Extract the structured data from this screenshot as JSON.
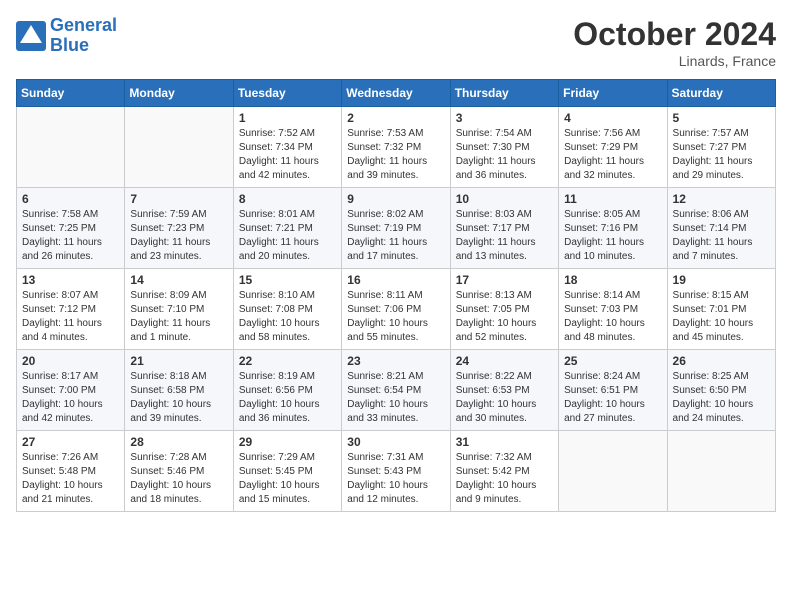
{
  "header": {
    "logo_line1": "General",
    "logo_line2": "Blue",
    "month": "October 2024",
    "location": "Linards, France"
  },
  "weekdays": [
    "Sunday",
    "Monday",
    "Tuesday",
    "Wednesday",
    "Thursday",
    "Friday",
    "Saturday"
  ],
  "weeks": [
    [
      {
        "day": "",
        "info": ""
      },
      {
        "day": "",
        "info": ""
      },
      {
        "day": "1",
        "info": "Sunrise: 7:52 AM\nSunset: 7:34 PM\nDaylight: 11 hours and 42 minutes."
      },
      {
        "day": "2",
        "info": "Sunrise: 7:53 AM\nSunset: 7:32 PM\nDaylight: 11 hours and 39 minutes."
      },
      {
        "day": "3",
        "info": "Sunrise: 7:54 AM\nSunset: 7:30 PM\nDaylight: 11 hours and 36 minutes."
      },
      {
        "day": "4",
        "info": "Sunrise: 7:56 AM\nSunset: 7:29 PM\nDaylight: 11 hours and 32 minutes."
      },
      {
        "day": "5",
        "info": "Sunrise: 7:57 AM\nSunset: 7:27 PM\nDaylight: 11 hours and 29 minutes."
      }
    ],
    [
      {
        "day": "6",
        "info": "Sunrise: 7:58 AM\nSunset: 7:25 PM\nDaylight: 11 hours and 26 minutes."
      },
      {
        "day": "7",
        "info": "Sunrise: 7:59 AM\nSunset: 7:23 PM\nDaylight: 11 hours and 23 minutes."
      },
      {
        "day": "8",
        "info": "Sunrise: 8:01 AM\nSunset: 7:21 PM\nDaylight: 11 hours and 20 minutes."
      },
      {
        "day": "9",
        "info": "Sunrise: 8:02 AM\nSunset: 7:19 PM\nDaylight: 11 hours and 17 minutes."
      },
      {
        "day": "10",
        "info": "Sunrise: 8:03 AM\nSunset: 7:17 PM\nDaylight: 11 hours and 13 minutes."
      },
      {
        "day": "11",
        "info": "Sunrise: 8:05 AM\nSunset: 7:16 PM\nDaylight: 11 hours and 10 minutes."
      },
      {
        "day": "12",
        "info": "Sunrise: 8:06 AM\nSunset: 7:14 PM\nDaylight: 11 hours and 7 minutes."
      }
    ],
    [
      {
        "day": "13",
        "info": "Sunrise: 8:07 AM\nSunset: 7:12 PM\nDaylight: 11 hours and 4 minutes."
      },
      {
        "day": "14",
        "info": "Sunrise: 8:09 AM\nSunset: 7:10 PM\nDaylight: 11 hours and 1 minute."
      },
      {
        "day": "15",
        "info": "Sunrise: 8:10 AM\nSunset: 7:08 PM\nDaylight: 10 hours and 58 minutes."
      },
      {
        "day": "16",
        "info": "Sunrise: 8:11 AM\nSunset: 7:06 PM\nDaylight: 10 hours and 55 minutes."
      },
      {
        "day": "17",
        "info": "Sunrise: 8:13 AM\nSunset: 7:05 PM\nDaylight: 10 hours and 52 minutes."
      },
      {
        "day": "18",
        "info": "Sunrise: 8:14 AM\nSunset: 7:03 PM\nDaylight: 10 hours and 48 minutes."
      },
      {
        "day": "19",
        "info": "Sunrise: 8:15 AM\nSunset: 7:01 PM\nDaylight: 10 hours and 45 minutes."
      }
    ],
    [
      {
        "day": "20",
        "info": "Sunrise: 8:17 AM\nSunset: 7:00 PM\nDaylight: 10 hours and 42 minutes."
      },
      {
        "day": "21",
        "info": "Sunrise: 8:18 AM\nSunset: 6:58 PM\nDaylight: 10 hours and 39 minutes."
      },
      {
        "day": "22",
        "info": "Sunrise: 8:19 AM\nSunset: 6:56 PM\nDaylight: 10 hours and 36 minutes."
      },
      {
        "day": "23",
        "info": "Sunrise: 8:21 AM\nSunset: 6:54 PM\nDaylight: 10 hours and 33 minutes."
      },
      {
        "day": "24",
        "info": "Sunrise: 8:22 AM\nSunset: 6:53 PM\nDaylight: 10 hours and 30 minutes."
      },
      {
        "day": "25",
        "info": "Sunrise: 8:24 AM\nSunset: 6:51 PM\nDaylight: 10 hours and 27 minutes."
      },
      {
        "day": "26",
        "info": "Sunrise: 8:25 AM\nSunset: 6:50 PM\nDaylight: 10 hours and 24 minutes."
      }
    ],
    [
      {
        "day": "27",
        "info": "Sunrise: 7:26 AM\nSunset: 5:48 PM\nDaylight: 10 hours and 21 minutes."
      },
      {
        "day": "28",
        "info": "Sunrise: 7:28 AM\nSunset: 5:46 PM\nDaylight: 10 hours and 18 minutes."
      },
      {
        "day": "29",
        "info": "Sunrise: 7:29 AM\nSunset: 5:45 PM\nDaylight: 10 hours and 15 minutes."
      },
      {
        "day": "30",
        "info": "Sunrise: 7:31 AM\nSunset: 5:43 PM\nDaylight: 10 hours and 12 minutes."
      },
      {
        "day": "31",
        "info": "Sunrise: 7:32 AM\nSunset: 5:42 PM\nDaylight: 10 hours and 9 minutes."
      },
      {
        "day": "",
        "info": ""
      },
      {
        "day": "",
        "info": ""
      }
    ]
  ]
}
